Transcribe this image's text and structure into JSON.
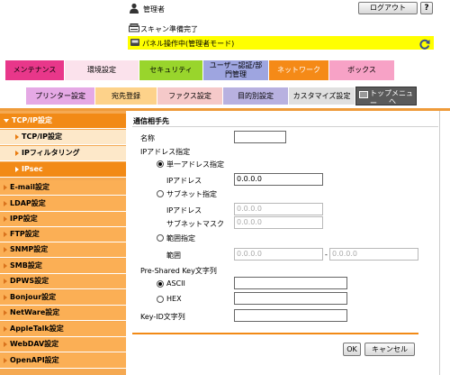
{
  "header": {
    "user_label": "管理者",
    "logout_label": "ログアウト",
    "help_label": "?",
    "scan_status": "スキャン準備完了",
    "panel_status": "パネル操作中(管理者モード)"
  },
  "main_tabs": [
    {
      "label": "メンテナンス",
      "color": "#e8378a"
    },
    {
      "label": "環境設定",
      "color": "#fbe2ec"
    },
    {
      "label": "セキュリティ",
      "color": "#99d52c"
    },
    {
      "label_line1": "ユーザー認証/部",
      "label_line2": "門管理",
      "color": "#9ea5e0"
    },
    {
      "label": "ネットワーク",
      "color": "#f58a17"
    },
    {
      "label": "ボックス",
      "color": "#f7a2c6"
    }
  ],
  "sub_tabs": [
    {
      "label": "プリンター設定",
      "color": "#e5a9e5"
    },
    {
      "label": "宛先登録",
      "color": "#fdd28a"
    },
    {
      "label": "ファクス設定",
      "color": "#f5c9c9"
    },
    {
      "label": "目的別設定",
      "color": "#b8b1e0"
    },
    {
      "label": "カスタマイズ設定",
      "color": "#e0e0e0"
    }
  ],
  "top_menu": {
    "line1": "トップメニュー",
    "line2": "へ"
  },
  "sidebar": {
    "items": [
      {
        "label": "TCP/IP設定",
        "kind": "header"
      },
      {
        "label": "TCP/IP設定",
        "kind": "sub"
      },
      {
        "label": "IPフィルタリング",
        "kind": "sub"
      },
      {
        "label": "IPsec",
        "kind": "active"
      },
      {
        "label": "E-mail設定",
        "kind": "main"
      },
      {
        "label": "LDAP設定",
        "kind": "main"
      },
      {
        "label": "IPP設定",
        "kind": "main"
      },
      {
        "label": "FTP設定",
        "kind": "main"
      },
      {
        "label": "SNMP設定",
        "kind": "main"
      },
      {
        "label": "SMB設定",
        "kind": "main"
      },
      {
        "label": "DPWS設定",
        "kind": "main"
      },
      {
        "label": "Bonjour設定",
        "kind": "main"
      },
      {
        "label": "NetWare設定",
        "kind": "main"
      },
      {
        "label": "AppleTalk設定",
        "kind": "main"
      },
      {
        "label": "WebDAV設定",
        "kind": "main"
      },
      {
        "label": "OpenAPI設定",
        "kind": "main"
      }
    ]
  },
  "form": {
    "section_title": "通信相手先",
    "name_label": "名称",
    "name_value": "",
    "ip_spec_label": "IPアドレス指定",
    "single_label": "単一アドレス指定",
    "single_ip_label": "IPアドレス",
    "single_ip_value": "0.0.0.0",
    "subnet_label": "サブネット指定",
    "subnet_ip_label": "IPアドレス",
    "subnet_ip_value": "0.0.0.0",
    "subnet_mask_label": "サブネットマスク",
    "subnet_mask_value": "0.0.0.0",
    "range_label": "範囲指定",
    "range_field_label": "範囲",
    "range_from_value": "0.0.0.0",
    "range_sep": "-",
    "range_to_value": "0.0.0.0",
    "psk_label": "Pre-Shared Key文字列",
    "ascii_label": "ASCII",
    "ascii_value": "",
    "hex_label": "HEX",
    "hex_value": "",
    "keyid_label": "Key-ID文字列",
    "keyid_value": "",
    "ok_label": "OK",
    "cancel_label": "キャンセル",
    "selected_ip_mode": "single",
    "selected_psk_mode": "ascii"
  }
}
